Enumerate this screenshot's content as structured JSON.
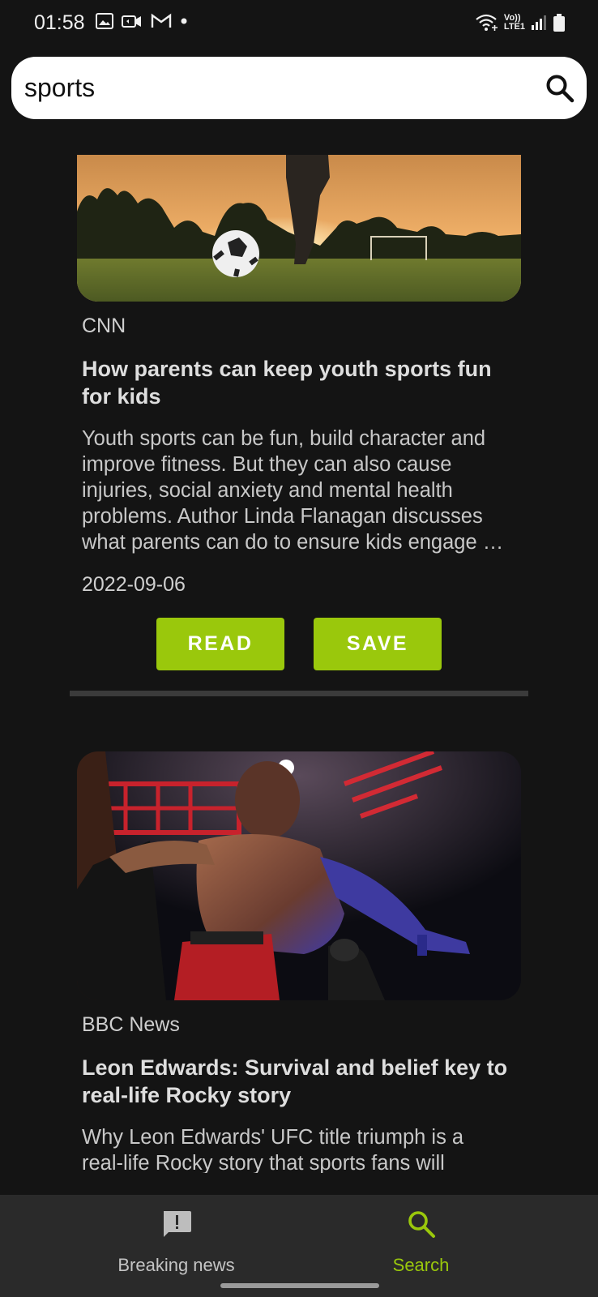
{
  "status_bar": {
    "time": "01:58",
    "icons": [
      "gallery-icon",
      "video-call-icon",
      "gmail-icon",
      "dot-icon"
    ],
    "right_icons": [
      "wifi-calling-icon",
      "volte-lte-icon",
      "signal-icon",
      "battery-icon"
    ],
    "volte_text": "Vo))",
    "lte_text": "LTE1"
  },
  "search": {
    "value": "sports",
    "placeholder": ""
  },
  "articles": [
    {
      "image": "soccer-sunset-image",
      "source": "CNN",
      "title_lines": [
        "How parents can keep youth sports fun",
        "for kids"
      ],
      "desc_lines": [
        "Youth sports can be fun, build character and",
        "improve fitness. But they can also cause",
        "injuries, social anxiety and mental health",
        "problems. Author Linda Flanagan discusses",
        "what parents can do to ensure kids engage …"
      ],
      "date": "2022-09-06",
      "read_label": "READ",
      "save_label": "SAVE"
    },
    {
      "image": "ufc-fighter-image",
      "source": "BBC News",
      "title_lines": [
        "Leon Edwards: Survival and belief key to",
        "real-life Rocky story"
      ],
      "desc_lines": [
        "Why Leon Edwards' UFC title triumph is a",
        "real-life Rocky story that sports fans will"
      ]
    }
  ],
  "bottom_nav": {
    "items": [
      {
        "label": "Breaking news",
        "icon": "announcement-icon",
        "active": false
      },
      {
        "label": "Search",
        "icon": "search-icon",
        "active": true
      }
    ]
  },
  "colors": {
    "accent": "#9ac80c",
    "background": "#141414",
    "nav_background": "#2a2a2a",
    "inactive_nav": "#c4c4c4"
  }
}
